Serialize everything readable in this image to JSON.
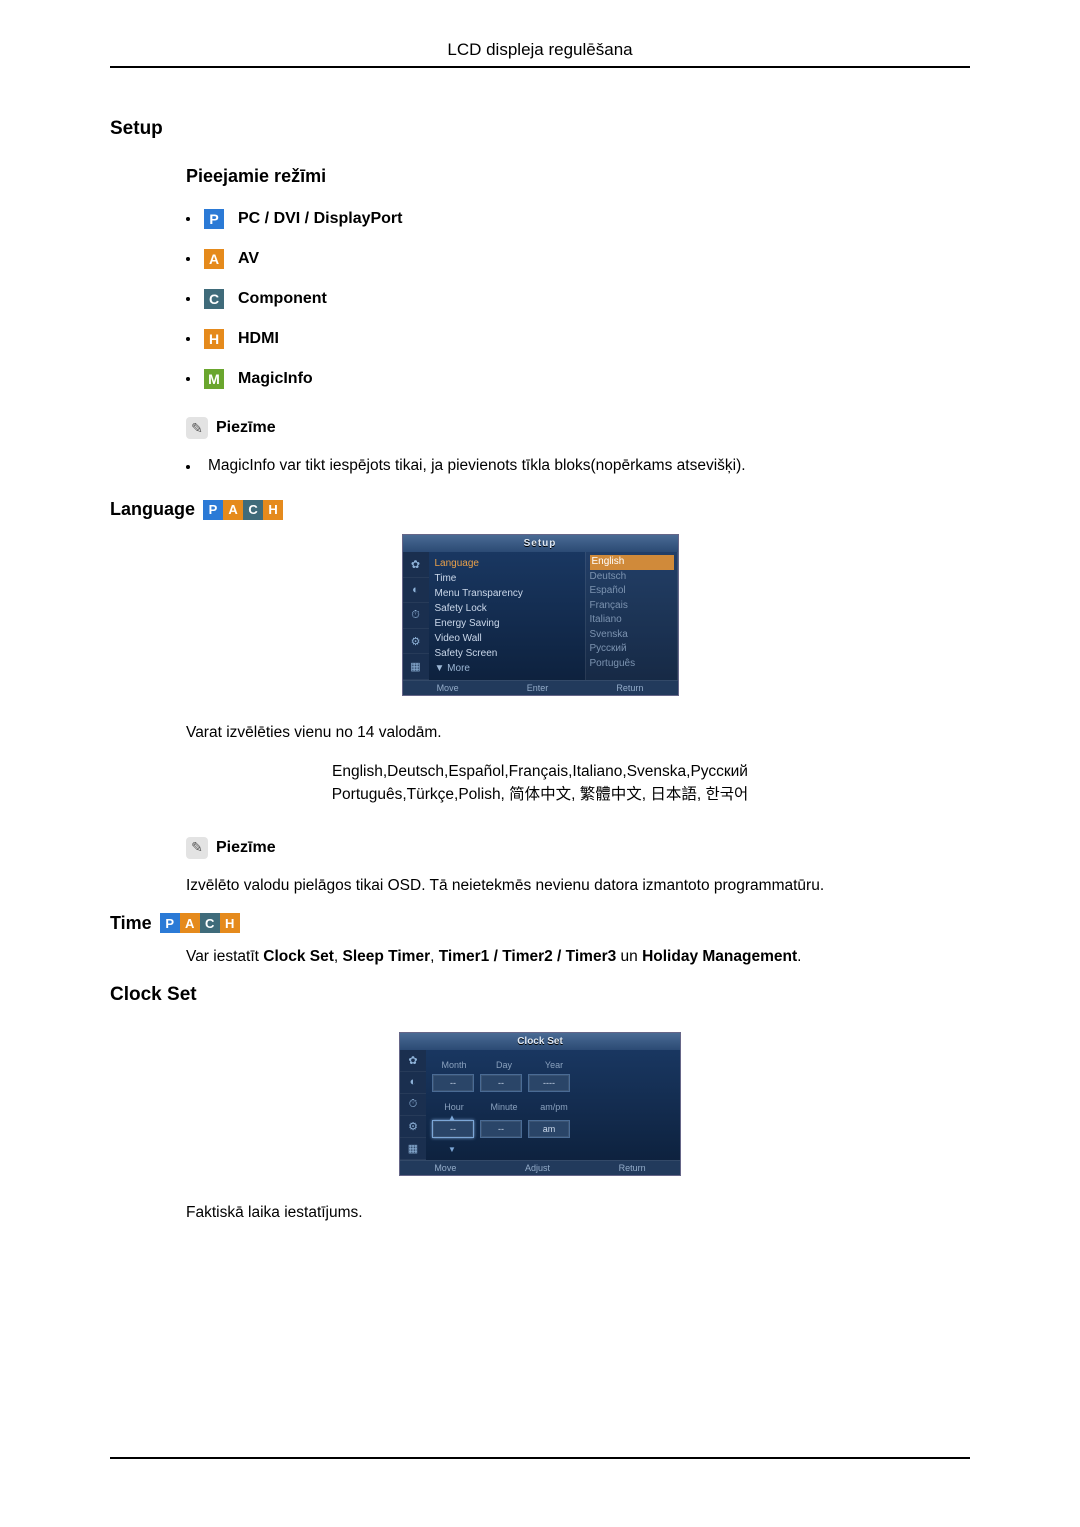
{
  "header": {
    "title": "LCD displeja regulēšana"
  },
  "setup": {
    "heading": "Setup",
    "modes_heading": "Pieejamie režīmi",
    "modes": [
      {
        "badge": "P",
        "cls": "badge-P",
        "label": "PC / DVI / DisplayPort"
      },
      {
        "badge": "A",
        "cls": "badge-A",
        "label": "AV"
      },
      {
        "badge": "C",
        "cls": "badge-C",
        "label": "Component"
      },
      {
        "badge": "H",
        "cls": "badge-H",
        "label": "HDMI"
      },
      {
        "badge": "M",
        "cls": "badge-M",
        "label": "MagicInfo"
      }
    ],
    "note_label": "Piezīme",
    "note_text": "MagicInfo var tikt iespējots tikai, ja pievienots tīkla bloks(nopērkams atsevišķi)."
  },
  "language": {
    "heading": "Language",
    "osd": {
      "title": "Setup",
      "menu": {
        "language": "Language",
        "time": "Time",
        "menu_transparency": "Menu Transparency",
        "safety_lock": "Safety Lock",
        "energy_saving": "Energy Saving",
        "video_wall": "Video Wall",
        "safety_screen": "Safety Screen",
        "more": "▼ More"
      },
      "langs": {
        "english": "English",
        "deutsch": "Deutsch",
        "espanol": "Español",
        "francais": "Français",
        "italiano": "Italiano",
        "svenska": "Svenska",
        "russian": "Русский",
        "portugues": "Português"
      },
      "footer": {
        "move": "Move",
        "enter": "Enter",
        "return": "Return"
      }
    },
    "choose_text": "Varat izvēlēties vienu no 14 valodām.",
    "langs_line1": "English,Deutsch,Español,Français,Italiano,Svenska,Русский",
    "langs_line2": "Português,Türkçe,Polish, 简体中文,  繁體中文, 日本語, 한국어",
    "note_label": "Piezīme",
    "note_text": "Izvēlēto valodu pielāgos tikai OSD. Tā neietekmēs nevienu datora izmantoto programmatūru."
  },
  "time": {
    "heading": "Time",
    "intro_prefix": "Var iestatīt ",
    "clock_set": "Clock Set",
    "sleep_timer": "Sleep Timer",
    "timers": "Timer1 / Timer2 / Timer3",
    "and": " un ",
    "holiday": "Holiday Management",
    "period": "."
  },
  "clock": {
    "heading": "Clock Set",
    "osd": {
      "title": "Clock Set",
      "month": "Month",
      "day": "Day",
      "year": "Year",
      "hour": "Hour",
      "minute": "Minute",
      "ampm_label": "am/pm",
      "ampm_value": "am",
      "dash": "--",
      "dashes4": "----",
      "footer": {
        "move": "Move",
        "adjust": "Adjust",
        "return": "Return"
      }
    },
    "caption": "Faktiskā laika iestatījums."
  },
  "sep": {
    "comma": ", "
  }
}
